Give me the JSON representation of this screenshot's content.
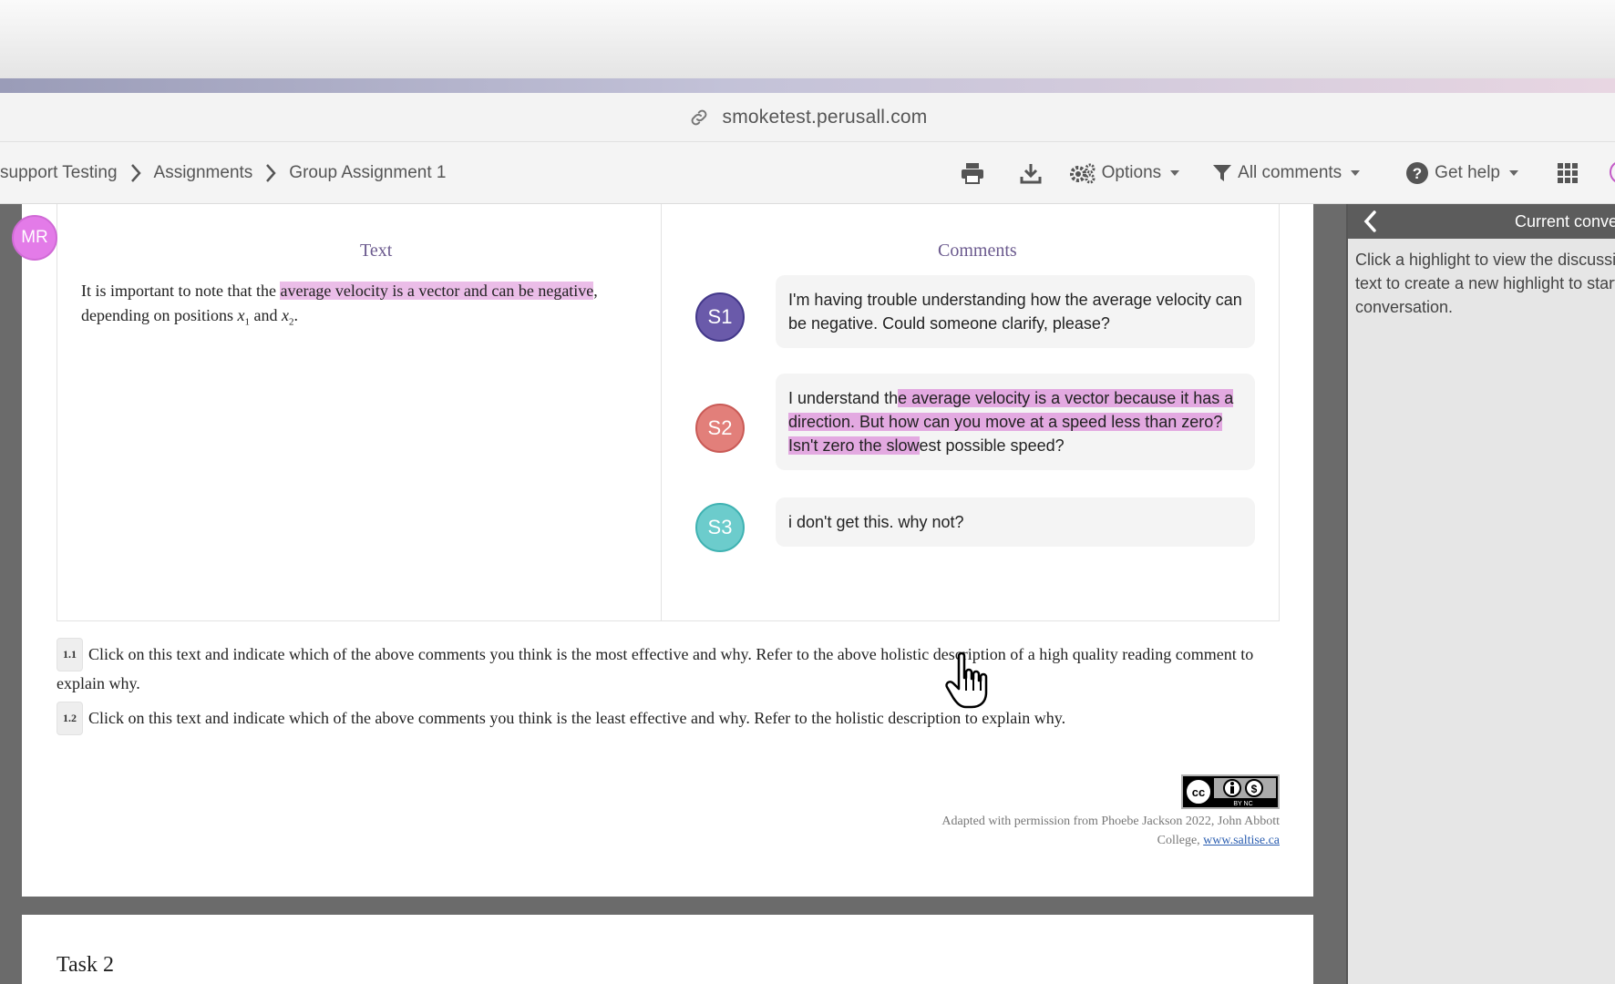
{
  "browser": {
    "url": "smoketest.perusall.com"
  },
  "breadcrumb": {
    "items": [
      "support Testing",
      "Assignments",
      "Group Assignment 1"
    ]
  },
  "toolbar": {
    "options_label": "Options",
    "filter_label": "All comments",
    "help_label": "Get help"
  },
  "user": {
    "initials": "MR"
  },
  "document": {
    "text_heading": "Text",
    "comments_heading": "Comments",
    "passage": {
      "before": "It is important to note that the ",
      "highlight": "average velocity is a vector and can be negative",
      "after": ", depending on positions ",
      "x1": "x",
      "x1_sub": "1",
      "and": " and ",
      "x2": "x",
      "x2_sub": "2",
      "end": "."
    },
    "comments": [
      {
        "initials": "S1",
        "color": "#6a5aaa",
        "text": "I'm having trouble understanding how the average velocity can be negative. Could someone clarify, please?"
      },
      {
        "initials": "S2",
        "color": "#e27f7a",
        "text_before": "I understand th",
        "text_highlight": "e average velocity is a vector because it has a direction. But how can you move at a speed less than zero? Isn't zero the slow",
        "text_after": "est possible speed?"
      },
      {
        "initials": "S3",
        "color": "#6ccccc",
        "text": "i don't get this. why not?"
      }
    ],
    "questions": [
      {
        "number": "1.1",
        "text": "Click on this text and indicate which of the above comments you think is the most effective and why. Refer to the above holistic description of a high quality reading comment to explain why."
      },
      {
        "number": "1.2",
        "text": "Click on this text and indicate which of the above comments you think is the least effective and why. Refer to the holistic description to explain why."
      }
    ],
    "license": {
      "badge_text": "BY NC"
    },
    "attribution": {
      "text": "Adapted with permission from Phoebe Jackson 2022, John Abbott College, ",
      "link": "www.saltise.ca"
    },
    "task2_title": "Task 2"
  },
  "panel": {
    "title": "Current conversation",
    "hint": "Click a highlight to view the discussion or select text to create a new highlight to start a conversation."
  },
  "colors": {
    "highlight": "#ebbde8",
    "user_avatar": "#e37be8",
    "heading_purple": "#6b5a8e"
  }
}
